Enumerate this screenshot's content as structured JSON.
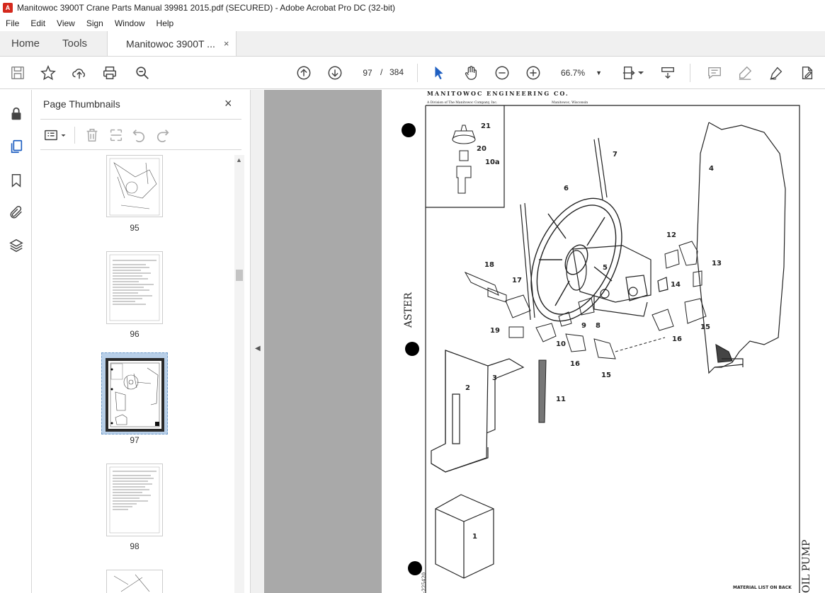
{
  "window": {
    "title": "Manitowoc 3900T Crane Parts Manual 39981 2015.pdf (SECURED) - Adobe Acrobat Pro DC (32-bit)"
  },
  "menu": [
    "File",
    "Edit",
    "View",
    "Sign",
    "Window",
    "Help"
  ],
  "tabs": {
    "home": "Home",
    "tools": "Tools",
    "document": "Manitowoc 3900T ...",
    "close": "×"
  },
  "toolbar": {
    "current_page": "97",
    "separator": "/",
    "total_pages": "384",
    "zoom": "66.7%"
  },
  "thumbnails_panel": {
    "title": "Page Thumbnails",
    "close": "×",
    "pages": [
      {
        "label": "95",
        "selected": false
      },
      {
        "label": "96",
        "selected": false
      },
      {
        "label": "97",
        "selected": true
      },
      {
        "label": "98",
        "selected": false
      }
    ]
  },
  "pdf_page": {
    "heading": "MANITOWOC ENGINEERING CO.",
    "subline_left": "A Division of The Manitowoc Company, Inc.",
    "subline_right": "Manitowoc, Wisconsin",
    "side_left": "ASTER",
    "side_right": "OIL PUMP",
    "footer": "MATERIAL LIST ON BACK",
    "drawing_number": "-225420",
    "callouts": [
      "21",
      "20",
      "10a",
      "7",
      "4",
      "6",
      "12",
      "13",
      "5",
      "18",
      "17",
      "14",
      "9",
      "8",
      "19",
      "10",
      "16",
      "15",
      "16",
      "15",
      "2",
      "3",
      "11",
      "1"
    ]
  }
}
